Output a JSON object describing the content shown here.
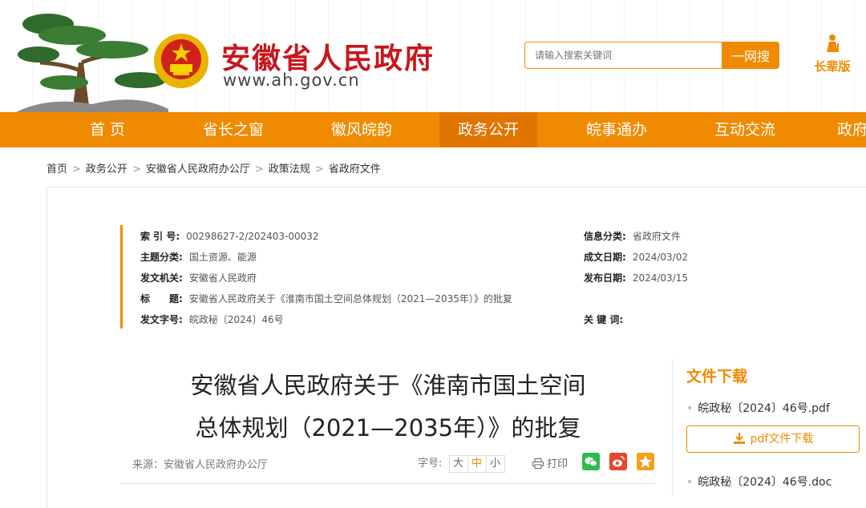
{
  "header": {
    "site_title": "安徽省人民政府",
    "site_url": "www.ah.gov.cn",
    "search_placeholder": "请输入搜索关键词",
    "search_button": "一网搜",
    "elder_label": "长辈版",
    "colors": {
      "accent": "#f08a00",
      "title_red": "#c8161d"
    }
  },
  "nav": {
    "items": [
      "首 页",
      "省长之窗",
      "徽风皖韵",
      "政务公开",
      "皖事通办",
      "互动交流",
      "政府"
    ],
    "active": "政务公开"
  },
  "breadcrumb": [
    "首页",
    "政务公开",
    "安徽省人民政府办公厅",
    "政策法规",
    "省政府文件"
  ],
  "meta": {
    "index_no_label": "索 引 号:",
    "index_no": "00298627-2/202403-00032",
    "topic_label": "主题分类:",
    "topic": "国土资源、能源",
    "issuer_label": "发文机关:",
    "issuer": "安徽省人民政府",
    "title_label": "标　　题:",
    "title": "安徽省人民政府关于《淮南市国土空间总体规划（2021—2035年）》的批复",
    "doc_no_label": "发文字号:",
    "doc_no": "皖政秘〔2024〕46号",
    "info_cat_label": "信息分类:",
    "info_cat": "省政府文件",
    "created_label": "成文日期:",
    "created": "2024/03/02",
    "published_label": "发布日期:",
    "published": "2024/03/15",
    "keywords_label": "关 键 词:",
    "keywords": ""
  },
  "article": {
    "title_line1": "安徽省人民政府关于《淮南市国土空间",
    "title_line2": "总体规划（2021—2035年）》的批复",
    "source": "来源：安徽省人民政府办公厅",
    "fontsize_label": "字号:",
    "fontsize_options": [
      "大",
      "中",
      "小"
    ],
    "fontsize_selected": "中",
    "print_label": "打印"
  },
  "downloads": {
    "title": "文件下载",
    "file1": "皖政秘〔2024〕46号.pdf",
    "button": "pdf文件下载",
    "file2": "皖政秘〔2024〕46号.doc"
  }
}
